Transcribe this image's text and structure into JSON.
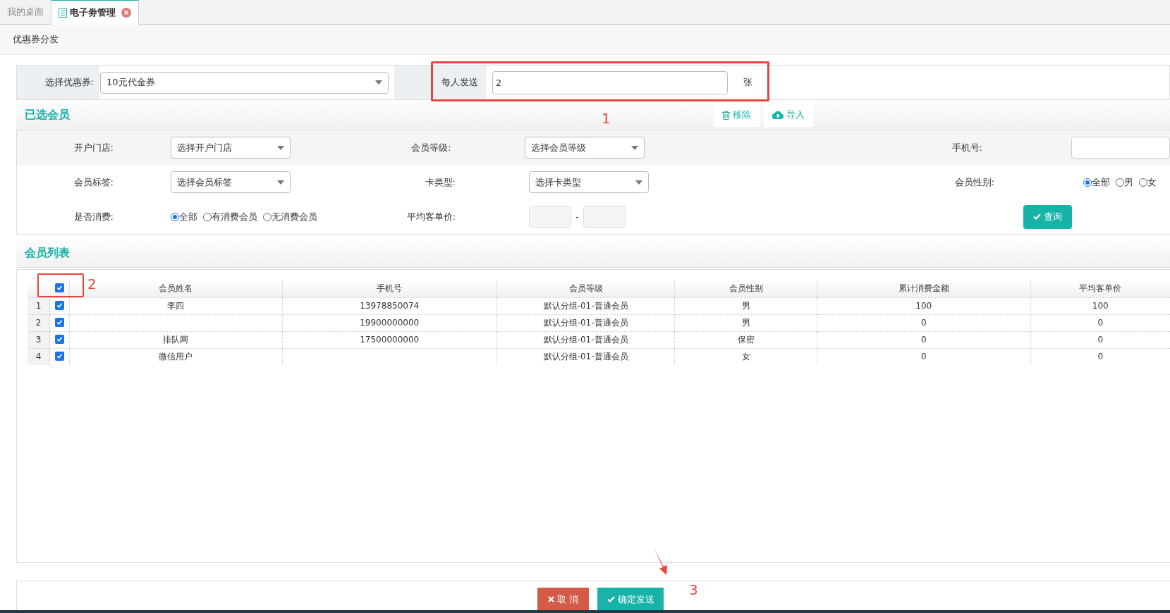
{
  "tabs": [
    {
      "label": "我的桌面",
      "selected": false,
      "closable": false
    },
    {
      "label": "电子劵管理",
      "selected": true,
      "closable": true
    }
  ],
  "breadcrumb": "优惠券分发",
  "coupon": {
    "label": "选择优惠券:",
    "value": "10元代金券",
    "per_person_label": "每人发送",
    "per_person_value": "2",
    "unit": "张"
  },
  "selected_members": {
    "title": "已选会员",
    "actions": [
      {
        "kind": "trash",
        "label": "移除"
      },
      {
        "kind": "upload",
        "label": "导入"
      }
    ]
  },
  "filters": {
    "store_label": "开户门店:",
    "store_placeholder": "选择开户门店",
    "level_label": "会员等级:",
    "level_placeholder": "选择会员等级",
    "phone_label": "手机号:",
    "tag_label": "会员标签:",
    "tag_placeholder": "选择会员标签",
    "card_label": "卡类型:",
    "card_placeholder": "选择卡类型",
    "gender_label": "会员性别:",
    "gender_options": [
      {
        "label": "全部",
        "selected": true
      },
      {
        "label": "男",
        "selected": false
      },
      {
        "label": "女",
        "selected": false
      }
    ],
    "consume_label": "是否消费:",
    "consume_options": [
      {
        "label": "全部",
        "selected": true
      },
      {
        "label": "有消费会员",
        "selected": false
      },
      {
        "label": "无消费会员",
        "selected": false
      }
    ],
    "avg_label": "平均客单价:",
    "range_sep": "-",
    "query_button": "查询"
  },
  "member_list": {
    "title": "会员列表",
    "select_all": true,
    "columns": [
      "会员姓名",
      "手机号",
      "会员等级",
      "会员性别",
      "累计消费金额",
      "平均客单价"
    ],
    "rows": [
      {
        "index": "1",
        "checked": true,
        "cells": [
          "李四",
          "13978850074",
          "默认分组-01-普通会员",
          "男",
          "100",
          "100"
        ]
      },
      {
        "index": "2",
        "checked": true,
        "cells": [
          "",
          "19900000000",
          "默认分组-01-普通会员",
          "男",
          "0",
          "0"
        ]
      },
      {
        "index": "3",
        "checked": true,
        "cells": [
          "排队网",
          "17500000000",
          "默认分组-01-普通会员",
          "保密",
          "0",
          "0"
        ]
      },
      {
        "index": "4",
        "checked": true,
        "cells": [
          "微信用户",
          "",
          "默认分组-01-普通会员",
          "女",
          "0",
          "0"
        ]
      }
    ]
  },
  "footer": {
    "cancel": "取 消",
    "confirm": "确定发送"
  },
  "annotations": [
    "1",
    "2",
    "3"
  ]
}
